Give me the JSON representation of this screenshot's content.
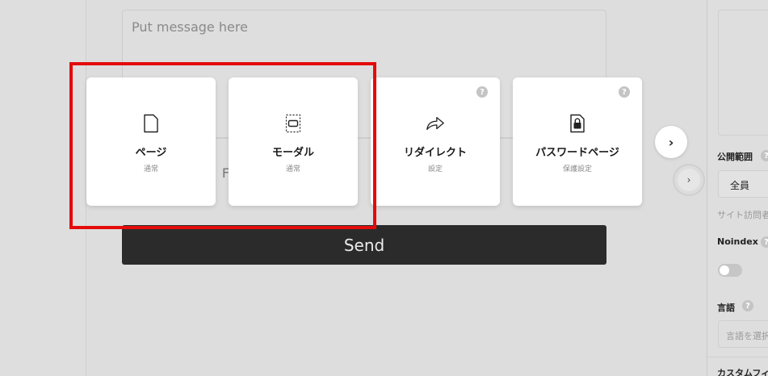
{
  "message": {
    "placeholder": "Put message here",
    "partial_text": "e F"
  },
  "send_label": "Send",
  "cards": [
    {
      "title": "ページ",
      "subtitle": "通常",
      "icon": "page-icon"
    },
    {
      "title": "モーダル",
      "subtitle": "通常",
      "icon": "modal-icon"
    },
    {
      "title": "リダイレクト",
      "subtitle": "設定",
      "icon": "redirect-arrow-icon",
      "help": "?"
    },
    {
      "title": "パスワードページ",
      "subtitle": "保護設定",
      "icon": "lock-icon",
      "help": "?"
    }
  ],
  "next_glyph": "›",
  "side_nav_glyph": "›",
  "right_panel": {
    "visibility_label": "公開範囲",
    "visibility_value": "全員",
    "visibility_hint": "サイト訪問者",
    "noindex_label": "Noindex",
    "language_label": "言語",
    "language_placeholder": "言語を選択",
    "custom_label": "カスタムフィ",
    "help": "?"
  },
  "colors": {
    "highlight": "#e40b0b",
    "send_button": "#2b2b2b",
    "card_bg": "#ffffff",
    "overlay_bg": "#dcdcdc"
  }
}
